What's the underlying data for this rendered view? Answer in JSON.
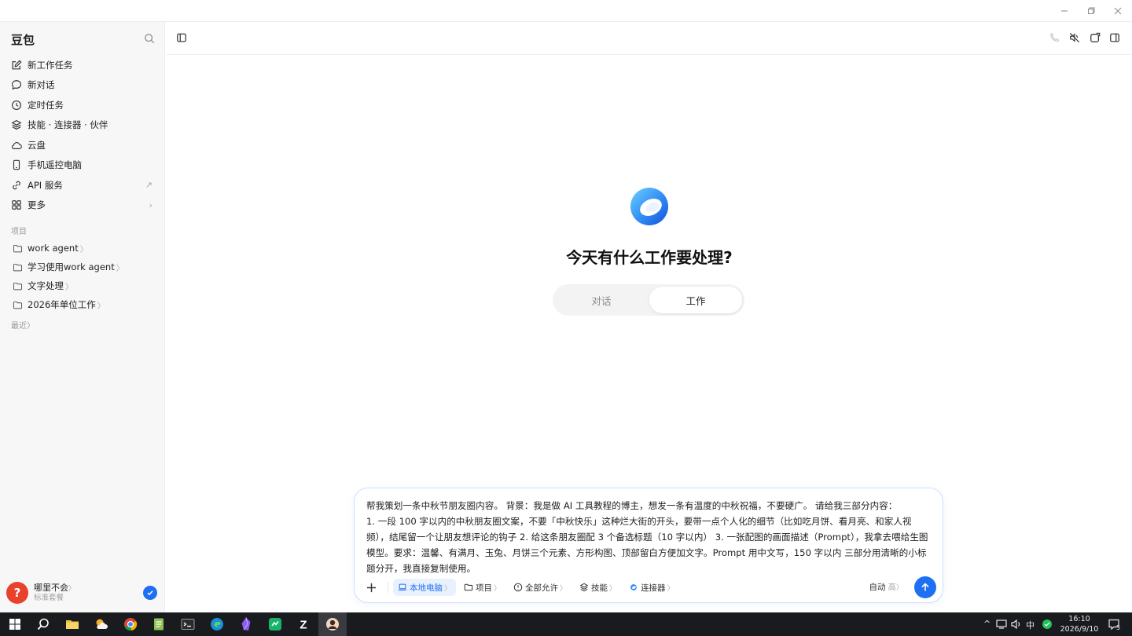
{
  "app": {
    "brand": "豆包"
  },
  "sidebar": {
    "nav": [
      {
        "label": "新工作任务",
        "icon": "edit-icon"
      },
      {
        "label": "新对话",
        "icon": "chat-bubble-icon"
      },
      {
        "label": "定时任务",
        "icon": "clock-icon"
      },
      {
        "label": "技能 · 连接器 · 伙伴",
        "icon": "layers-icon"
      },
      {
        "label": "云盘",
        "icon": "cloud-icon"
      },
      {
        "label": "手机遥控电脑",
        "icon": "phone-icon"
      },
      {
        "label": "API 服务",
        "icon": "link-icon",
        "trail": "↗"
      },
      {
        "label": "更多",
        "icon": "grid-icon",
        "trail": "›"
      }
    ],
    "projects_label": "项目",
    "projects": [
      {
        "label": "work agent"
      },
      {
        "label": "学习使用work agent"
      },
      {
        "label": "文字处理"
      },
      {
        "label": "2026年单位工作"
      }
    ],
    "recent_label": "最近",
    "user": {
      "avatar_char": "?",
      "name": "哪里不会",
      "plan": "标准套餐"
    }
  },
  "main": {
    "hero_title": "今天有什么工作要处理?",
    "modes": [
      {
        "label": "对话",
        "active": false
      },
      {
        "label": "工作",
        "active": true
      }
    ]
  },
  "composer": {
    "text": "帮我策划一条中秋节朋友圈内容。 背景：我是做 AI 工具教程的博主，想发一条有温度的中秋祝福，不要硬广。 请给我三部分内容：\n1. 一段 100 字以内的中秋朋友圈文案，不要「中秋快乐」这种烂大街的开头，要带一点个人化的细节（比如吃月饼、看月亮、和家人视频），结尾留一个让朋友想评论的钩子 2. 给这条朋友圈配 3 个备选标题（10 字以内） 3. 一张配图的画面描述（Prompt），我拿去喂给生图模型。要求：温馨、有满月、玉兔、月饼三个元素、方形构图、顶部留白方便加文字。Prompt 用中文写，150 字以内 三部分用清晰的小标题分开，我直接复制使用。",
    "chips": [
      {
        "label": "本地电脑",
        "icon": "laptop-icon",
        "active": true
      },
      {
        "label": "项目",
        "icon": "folder-icon",
        "active": false
      },
      {
        "label": "全部允许",
        "icon": "shield-info-icon",
        "active": false
      },
      {
        "label": "技能",
        "icon": "layers-icon",
        "active": false
      },
      {
        "label": "连接器",
        "icon": "connector-icon",
        "active": false
      }
    ],
    "mode": "自动",
    "level": "高"
  },
  "taskbar": {
    "time": "16:10",
    "date": "2026/9/10",
    "ime": "中",
    "notification_count": "5"
  },
  "colors": {
    "accent": "#1f6ff2",
    "sidebar_bg": "#f7f7f8",
    "taskbar_bg": "#1a1b1f"
  }
}
